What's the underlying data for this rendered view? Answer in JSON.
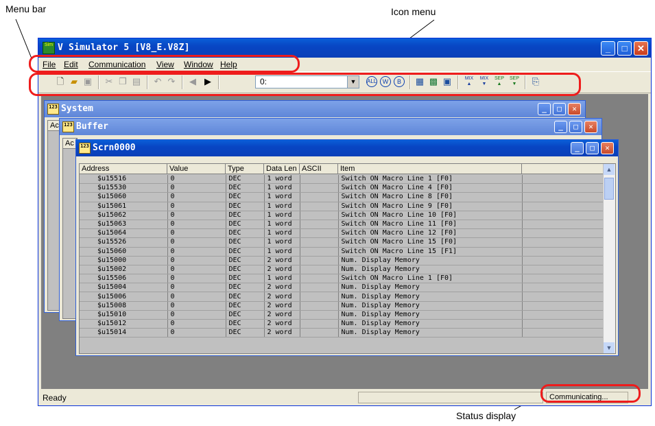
{
  "annotations": {
    "menu_bar": "Menu bar",
    "icon_menu": "Icon menu",
    "status_display": "Status display"
  },
  "app": {
    "title": "V Simulator 5 [V8_E.V8Z]",
    "icon_text": "Sim",
    "menu": [
      "File",
      "Edit",
      "Communication",
      "View",
      "Window",
      "Help"
    ],
    "toolbar": {
      "combo_value": "0:",
      "icons": [
        "new-icon",
        "open-icon",
        "save-icon",
        "cut-icon",
        "copy-icon",
        "paste-icon",
        "undo-icon",
        "redo-icon",
        "back-icon",
        "forward-icon",
        "all-icon",
        "w-icon",
        "b-icon",
        "screen1-icon",
        "screen2-icon",
        "screen3-icon",
        "mix-up-icon",
        "mix-down-icon",
        "sep-up-icon",
        "sep-down-icon",
        "exit-icon"
      ],
      "labels": {
        "all": "ALL",
        "w": "W",
        "b": "B",
        "mix1": "MIX",
        "mix2": "MIX",
        "sep1": "SEP",
        "sep2": "SEP"
      }
    },
    "status": {
      "left": "Ready",
      "right": "Communicating..."
    }
  },
  "windows": {
    "system": {
      "title": "System",
      "header_stub": "Ac"
    },
    "buffer": {
      "title": "Buffer",
      "header_stub": "Ac"
    },
    "scrn": {
      "title": "Scrn0000",
      "columns": [
        "Address",
        "Value",
        "Type",
        "Data Len",
        "ASCII",
        "Item"
      ],
      "rows": [
        [
          "$u15516",
          "0",
          "DEC",
          "1 word",
          "",
          "Switch ON Macro Line 1 [F0]"
        ],
        [
          "$u15530",
          "0",
          "DEC",
          "1 word",
          "",
          "Switch ON Macro Line 4 [F0]"
        ],
        [
          "$u15060",
          "0",
          "DEC",
          "1 word",
          "",
          "Switch ON Macro Line 8 [F0]"
        ],
        [
          "$u15061",
          "0",
          "DEC",
          "1 word",
          "",
          "Switch ON Macro Line 9 [F0]"
        ],
        [
          "$u15062",
          "0",
          "DEC",
          "1 word",
          "",
          "Switch ON Macro Line 10 [F0]"
        ],
        [
          "$u15063",
          "0",
          "DEC",
          "1 word",
          "",
          "Switch ON Macro Line 11 [F0]"
        ],
        [
          "$u15064",
          "0",
          "DEC",
          "1 word",
          "",
          "Switch ON Macro Line 12 [F0]"
        ],
        [
          "$u15526",
          "0",
          "DEC",
          "1 word",
          "",
          "Switch ON Macro Line 15 [F0]"
        ],
        [
          "$u15060",
          "0",
          "DEC",
          "1 word",
          "",
          "Switch ON Macro Line 15 [F1]"
        ],
        [
          "$u15000",
          "0",
          "DEC",
          "2 word",
          "",
          "Num. Display Memory"
        ],
        [
          "$u15002",
          "0",
          "DEC",
          "2 word",
          "",
          "Num. Display Memory"
        ],
        [
          "$u15506",
          "0",
          "DEC",
          "1 word",
          "",
          "Switch ON Macro Line 1 [F0]"
        ],
        [
          "$u15004",
          "0",
          "DEC",
          "2 word",
          "",
          "Num. Display Memory"
        ],
        [
          "$u15006",
          "0",
          "DEC",
          "2 word",
          "",
          "Num. Display Memory"
        ],
        [
          "$u15008",
          "0",
          "DEC",
          "2 word",
          "",
          "Num. Display Memory"
        ],
        [
          "$u15010",
          "0",
          "DEC",
          "2 word",
          "",
          "Num. Display Memory"
        ],
        [
          "$u15012",
          "0",
          "DEC",
          "2 word",
          "",
          "Num. Display Memory"
        ],
        [
          "$u15014",
          "0",
          "DEC",
          "2 word",
          "",
          "Num. Display Memory"
        ]
      ]
    }
  }
}
